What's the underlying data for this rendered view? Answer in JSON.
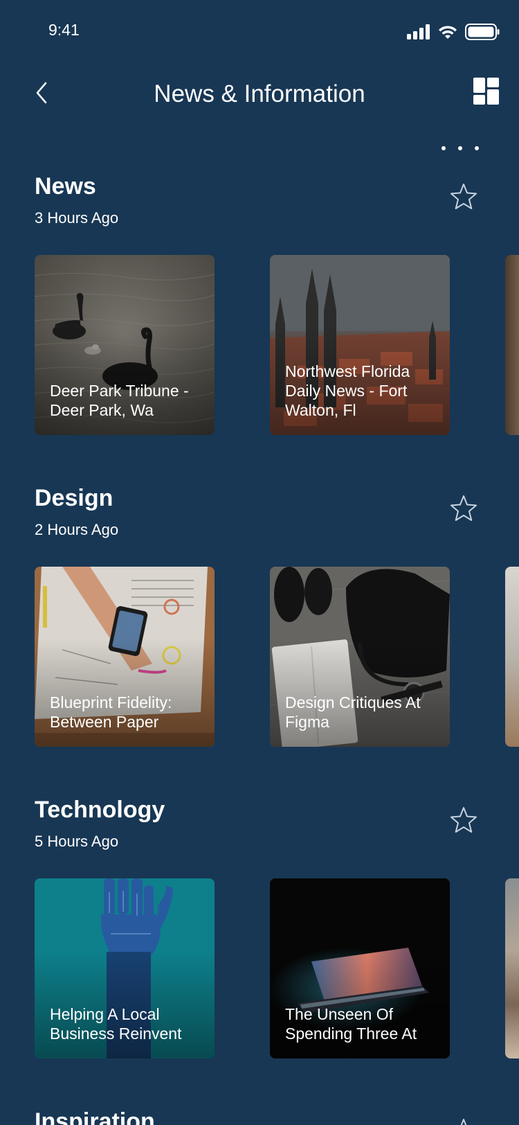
{
  "status": {
    "time": "9:41"
  },
  "nav": {
    "title": "News & Information"
  },
  "sections": [
    {
      "title": "News",
      "time": "3 Hours Ago",
      "cards": [
        {
          "title": "Deer Park Tribune - Deer Park, Wa"
        },
        {
          "title": "Northwest Florida Daily News - Fort Walton, Fl"
        }
      ]
    },
    {
      "title": "Design",
      "time": "2 Hours Ago",
      "cards": [
        {
          "title": "Blueprint Fidelity: Between Paper"
        },
        {
          "title": "Design Critiques At Figma"
        }
      ]
    },
    {
      "title": "Technology",
      "time": "5 Hours Ago",
      "cards": [
        {
          "title": "Helping A Local Business Reinvent"
        },
        {
          "title": "The Unseen Of Spending Three At"
        }
      ]
    },
    {
      "title": "Inspiration"
    }
  ],
  "colors": {
    "background": "#183754",
    "text": "#ffffff",
    "star_outline": "#c9d3de"
  },
  "icons": [
    "back-chevron-icon",
    "grid-view-icon",
    "more-dots-icon",
    "star-outline-icon",
    "signal-icon",
    "wifi-icon",
    "battery-icon"
  ]
}
